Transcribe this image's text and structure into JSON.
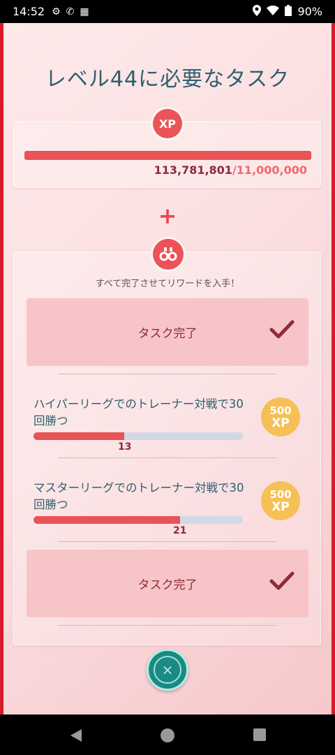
{
  "status_bar": {
    "time": "14:52",
    "battery": "90%",
    "icons": [
      "accessibility-icon",
      "call-icon",
      "parking-icon",
      "location-icon",
      "wifi-icon",
      "battery-icon"
    ]
  },
  "page": {
    "title": "レベル44に必要なタスク"
  },
  "xp": {
    "badge": "XP",
    "current": "113,781,801",
    "target": "/11,000,000",
    "progress": 1.0
  },
  "plus": "+",
  "tasks": {
    "subtitle": "すべて完了させてリワードを入手！",
    "items": [
      {
        "type": "done",
        "label": "タスク完了"
      },
      {
        "type": "progress",
        "name": "ハイパーリーグでのトレーナー対戦で30回勝つ",
        "count": "13",
        "goal": 30,
        "reward_amount": "500",
        "reward_unit": "XP"
      },
      {
        "type": "progress",
        "name": "マスターリーグでのトレーナー対戦で30回勝つ",
        "count": "21",
        "goal": 30,
        "reward_amount": "500",
        "reward_unit": "XP"
      },
      {
        "type": "done",
        "label": "タスク完了"
      }
    ]
  },
  "close_button": {
    "icon": "×"
  },
  "colors": {
    "accent_red": "#e85456",
    "title_teal": "#2f5f6e",
    "reward_gold": "#f6c056",
    "close_teal": "#1a8a83"
  }
}
